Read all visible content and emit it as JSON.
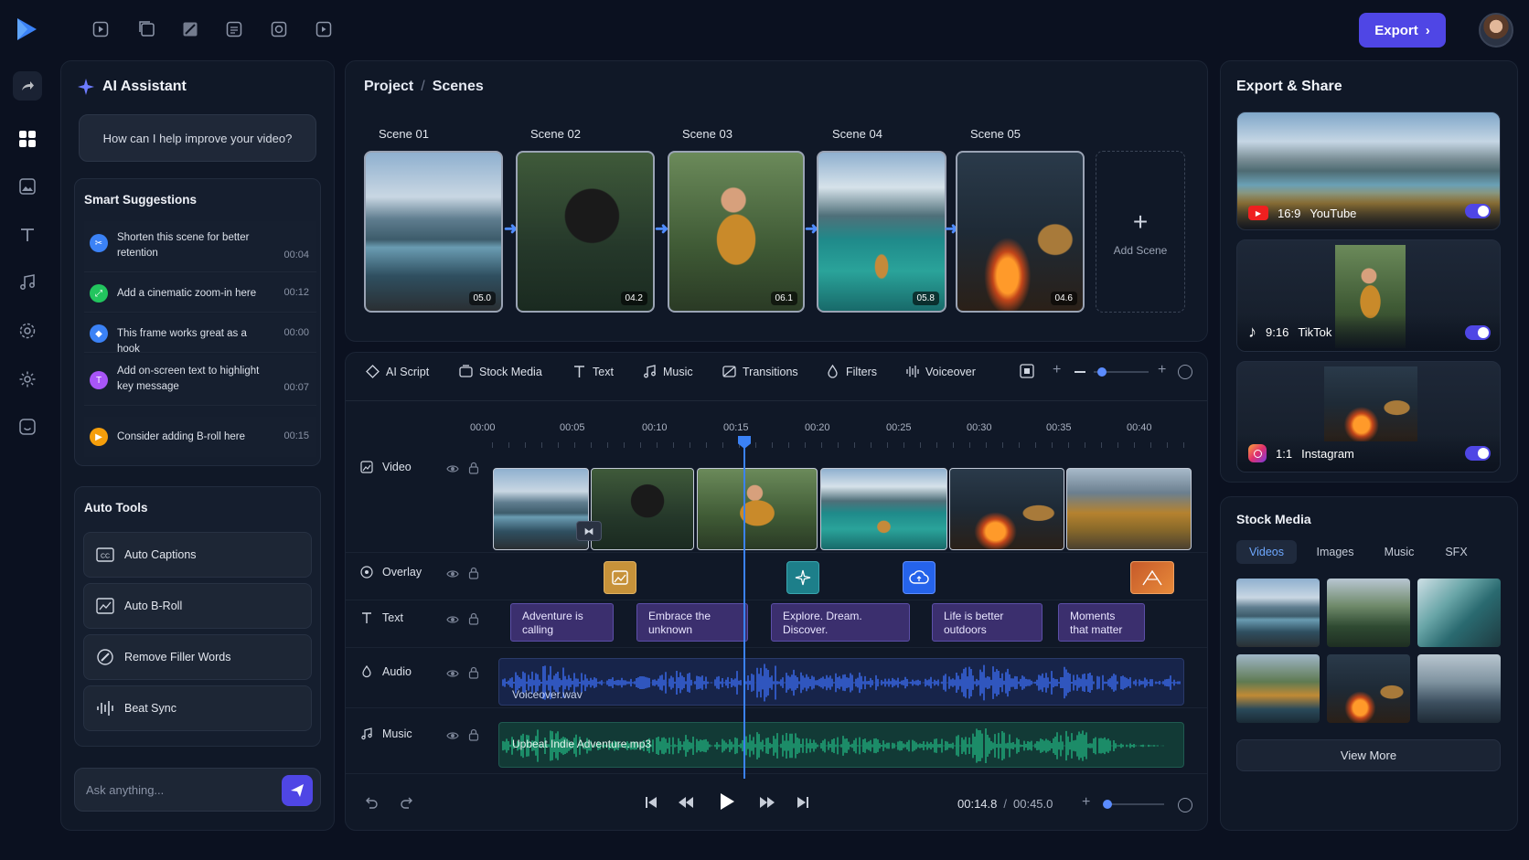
{
  "header": {
    "export_label": "Export"
  },
  "assistant": {
    "title": "AI Assistant",
    "prompt": "How can I help improve your video?",
    "suggestions_title": "Smart Suggestions",
    "suggestions": [
      {
        "text": "Shorten this scene for better retention",
        "time": "00:04",
        "color": "#3b82f6"
      },
      {
        "text": "Add a cinematic zoom-in here",
        "time": "00:12",
        "color": "#22c55e"
      },
      {
        "text": "This frame works great as a hook",
        "time": "00:00",
        "color": "#3b82f6"
      },
      {
        "text": "Add on-screen text to highlight key message",
        "time": "00:07",
        "color": "#a855f7"
      },
      {
        "text": "Consider adding B-roll here",
        "time": "00:15",
        "color": "#f59e0b"
      }
    ],
    "auto_tools_title": "Auto Tools",
    "tools": [
      "Auto Captions",
      "Auto B-Roll",
      "Remove Filler Words",
      "Beat Sync"
    ],
    "ask_placeholder": "Ask anything..."
  },
  "project": {
    "breadcrumb_root": "Project",
    "breadcrumb_sep": "/",
    "breadcrumb_current": "Scenes",
    "scenes": [
      {
        "label": "Scene 01",
        "duration": "05.0"
      },
      {
        "label": "Scene 02",
        "duration": "04.2"
      },
      {
        "label": "Scene 03",
        "duration": "06.1"
      },
      {
        "label": "Scene 04",
        "duration": "05.8"
      },
      {
        "label": "Scene 05",
        "duration": "04.6"
      }
    ],
    "add_scene": "Add Scene"
  },
  "toolbar": {
    "items": [
      "AI Script",
      "Stock Media",
      "Text",
      "Music",
      "Transitions",
      "Filters",
      "Voiceover"
    ],
    "zoom_level": 0.15
  },
  "timeline": {
    "ticks": [
      "00:00",
      "00:05",
      "00:10",
      "00:15",
      "00:20",
      "00:25",
      "00:30",
      "00:35",
      "00:40"
    ],
    "tracks": [
      "Video",
      "Overlay",
      "Text",
      "Audio",
      "Music"
    ],
    "text_clips": [
      "Adventure is calling",
      "Embrace the unknown",
      "Explore. Dream. Discover.",
      "Life is better outdoors",
      "Moments that matter"
    ],
    "audio_file": "Voiceover.wav",
    "music_file": "Upbeat Indie Adventure.mp3",
    "current_time": "00:14.8",
    "time_sep": "/",
    "total_time": "00:45.0",
    "volume_level": 0.05
  },
  "export_share": {
    "title": "Export & Share",
    "platforms": [
      {
        "ratio": "16:9",
        "name": "YouTube",
        "enabled": true
      },
      {
        "ratio": "9:16",
        "name": "TikTok",
        "enabled": true
      },
      {
        "ratio": "1:1",
        "name": "Instagram",
        "enabled": true
      }
    ]
  },
  "stock_media": {
    "title": "Stock Media",
    "tabs": [
      "Videos",
      "Images",
      "Music",
      "SFX"
    ],
    "active_tab": "Videos",
    "view_more": "View More"
  },
  "colors": {
    "accent": "#4f46e5",
    "playhead": "#3b82f6",
    "audio_wave": "#3b6cf0",
    "music_wave": "#22b07d"
  }
}
